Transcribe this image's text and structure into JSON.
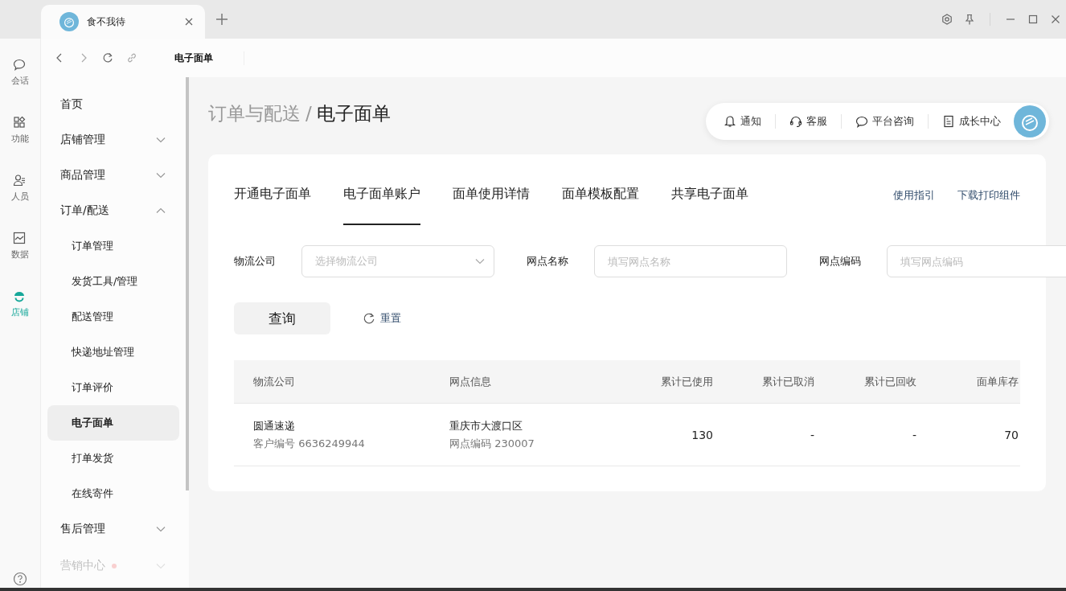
{
  "browser_tabs": [
    {
      "title": "食不我待"
    }
  ],
  "nav_bar": {
    "page_title": "电子面单"
  },
  "rail": [
    {
      "label": "会话",
      "selected": false
    },
    {
      "label": "功能",
      "selected": false
    },
    {
      "label": "人员",
      "selected": false
    },
    {
      "label": "数据",
      "selected": false
    },
    {
      "label": "店铺",
      "selected": true
    }
  ],
  "sidebar": [
    {
      "label": "首页",
      "selected": false
    },
    {
      "label": "店铺管理",
      "expanded": false,
      "selected": false
    },
    {
      "label": "商品管理",
      "expanded": false,
      "selected": false
    },
    {
      "label": "订单/配送",
      "expanded": true,
      "selected": false,
      "children": [
        {
          "label": "订单管理",
          "selected": false
        },
        {
          "label": "发货工具/管理",
          "selected": false
        },
        {
          "label": "配送管理",
          "selected": false
        },
        {
          "label": "快递地址管理",
          "selected": false
        },
        {
          "label": "订单评价",
          "selected": false
        },
        {
          "label": "电子面单",
          "selected": true
        },
        {
          "label": "打单发货",
          "selected": false
        },
        {
          "label": "在线寄件",
          "selected": false
        }
      ]
    },
    {
      "label": "售后管理",
      "expanded": false,
      "selected": false
    },
    {
      "label": "营销中心",
      "expanded": false,
      "selected": false,
      "notice": true
    }
  ],
  "breadcrumb": {
    "separator": "/",
    "items": [
      {
        "label": "订单与配送",
        "current": false
      },
      {
        "label": "电子面单",
        "current": true
      }
    ]
  },
  "header_actions": [
    {
      "label": "通知"
    },
    {
      "label": "客服"
    },
    {
      "label": "平台咨询"
    },
    {
      "label": "成长中心"
    }
  ],
  "tabs": [
    {
      "label": "开通电子面单",
      "selected": false
    },
    {
      "label": "电子面单账户",
      "selected": true
    },
    {
      "label": "面单使用详情",
      "selected": false
    },
    {
      "label": "面单模板配置",
      "selected": false
    },
    {
      "label": "共享电子面单",
      "selected": false
    }
  ],
  "links": [
    "使用指引",
    "下载打印组件"
  ],
  "filters": [
    {
      "label": "物流公司",
      "kind": "select",
      "placeholder": "选择物流公司"
    },
    {
      "label": "网点名称",
      "kind": "input",
      "placeholder": "填写网点名称"
    },
    {
      "label": "网点编码",
      "kind": "input",
      "placeholder": "填写网点编码"
    }
  ],
  "query_button": "查询",
  "reset_button": "重置",
  "table": {
    "columns": [
      "物流公司",
      "网点信息",
      "累计已使用",
      "累计已取消",
      "累计已回收",
      "面单库存"
    ],
    "rows": [
      {
        "company": "圆通速递",
        "customer_no": "客户编号 6636249944",
        "branch": "重庆市大渡口区",
        "branch_code": "网点编码 230007",
        "used": "130",
        "cancelled": "-",
        "recycled": "-",
        "stock": "70"
      }
    ]
  }
}
